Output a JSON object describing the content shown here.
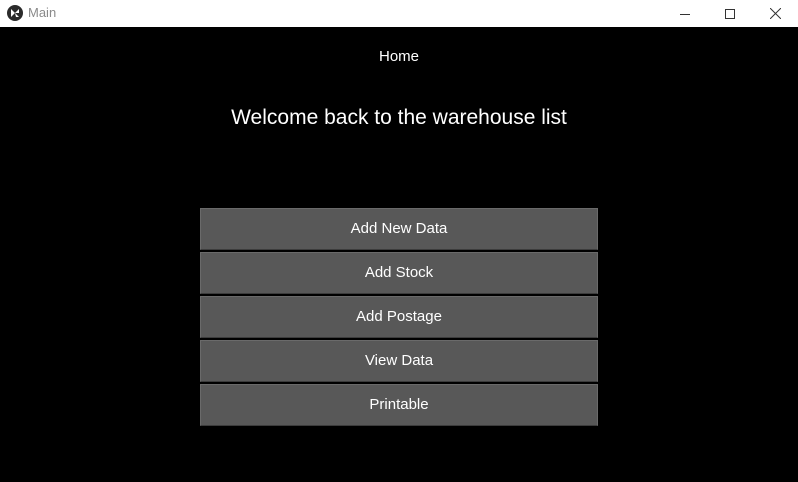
{
  "window": {
    "title": "Main",
    "app_icon": "kivy-logo-icon",
    "controls": {
      "minimize_icon": "minimize-icon",
      "maximize_icon": "maximize-icon",
      "close_icon": "close-icon"
    }
  },
  "screen": {
    "title": "Home",
    "welcome": "Welcome back to the warehouse list"
  },
  "menu": {
    "items": [
      {
        "label": "Add New Data"
      },
      {
        "label": "Add Stock"
      },
      {
        "label": "Add Postage"
      },
      {
        "label": "View Data"
      },
      {
        "label": "Printable"
      }
    ]
  },
  "colors": {
    "background": "#000000",
    "button": "#585858",
    "text": "#ffffff",
    "titlebar": "#ffffff"
  }
}
